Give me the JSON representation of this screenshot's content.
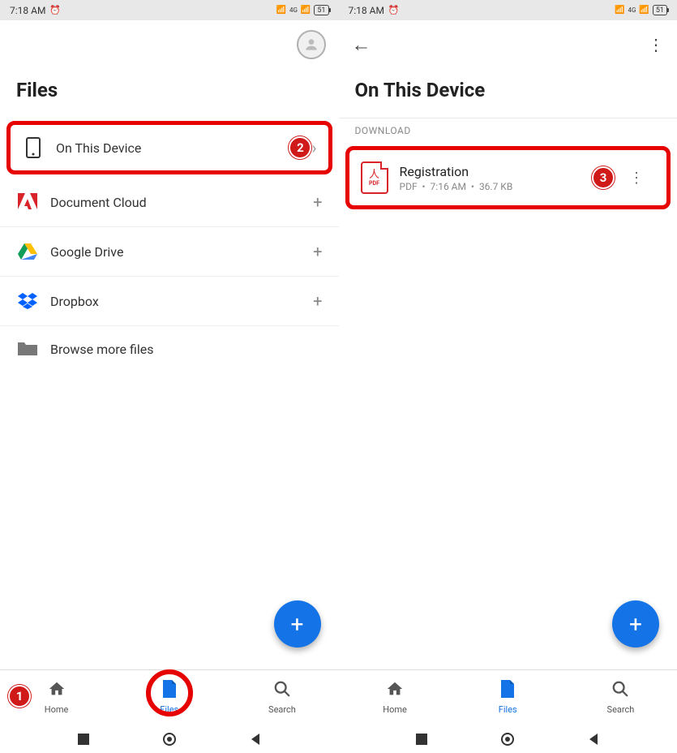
{
  "statusBar": {
    "time": "7:18 AM",
    "battery": "51",
    "networkLabel": "4G"
  },
  "leftPanel": {
    "title": "Files",
    "locations": [
      {
        "label": "On This Device",
        "icon": "phone",
        "action": "chevron",
        "highlighted": true,
        "badge": "2"
      },
      {
        "label": "Document Cloud",
        "icon": "adobe",
        "action": "plus"
      },
      {
        "label": "Google Drive",
        "icon": "gdrive",
        "action": "plus"
      },
      {
        "label": "Dropbox",
        "icon": "dropbox",
        "action": "plus"
      },
      {
        "label": "Browse more files",
        "icon": "folder",
        "action": "none"
      }
    ],
    "nav": {
      "home": "Home",
      "files": "Files",
      "search": "Search",
      "filesBadge": "1"
    },
    "fab": "+"
  },
  "rightPanel": {
    "title": "On This Device",
    "sectionLabel": "DOWNLOAD",
    "file": {
      "name": "Registration",
      "type": "PDF",
      "time": "7:16 AM",
      "size": "36.7 KB",
      "badge": "3"
    },
    "nav": {
      "home": "Home",
      "files": "Files",
      "search": "Search"
    },
    "fab": "+"
  }
}
